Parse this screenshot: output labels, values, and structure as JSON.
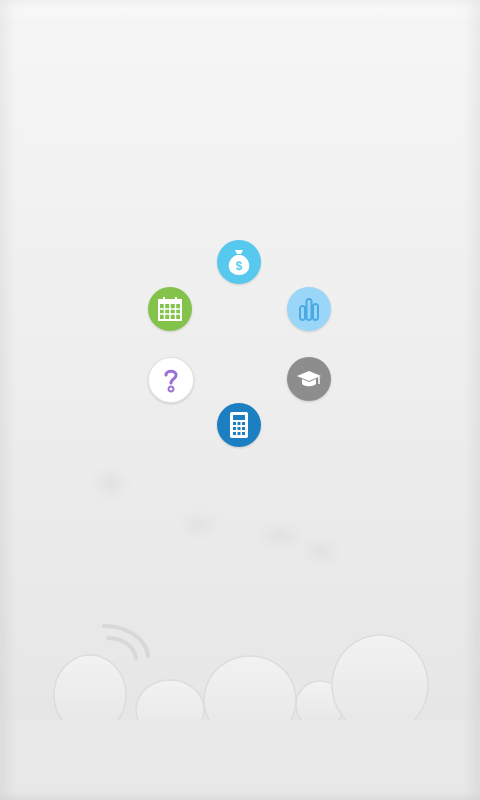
{
  "screen": {
    "background_top": "#f6f6f6",
    "background_bottom": "#e4e4e4"
  },
  "menu": {
    "items": [
      {
        "name": "money-bag",
        "icon": "money-bag-icon",
        "color": "#57c8ee"
      },
      {
        "name": "bar-chart",
        "icon": "bar-chart-icon",
        "color": "#9ad6f7"
      },
      {
        "name": "graduation",
        "icon": "graduation-cap-icon",
        "color": "#8d8d8d"
      },
      {
        "name": "calculator",
        "icon": "calculator-icon",
        "color": "#1c7fc2"
      },
      {
        "name": "help",
        "icon": "question-icon",
        "color": "#ffffff",
        "accent": "#9a6fd8"
      },
      {
        "name": "calendar",
        "icon": "calendar-icon",
        "color": "#84c34b"
      }
    ]
  }
}
